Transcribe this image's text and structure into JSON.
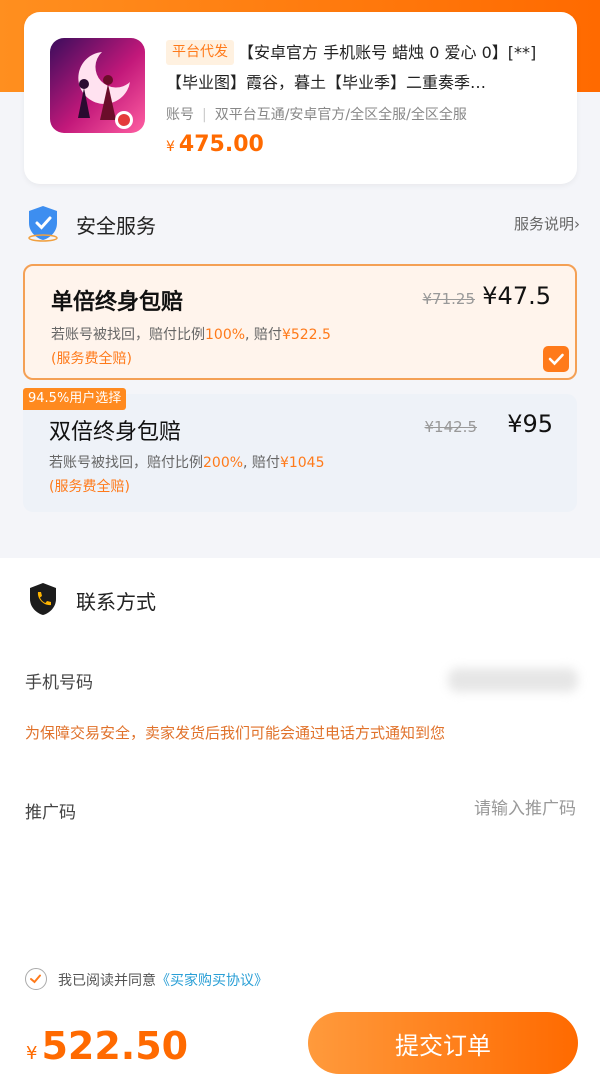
{
  "product": {
    "tag": "平台代发",
    "title": "【安卓官方 手机账号 蜡烛 0 爱心 0】[**]【毕业图】霞谷，暮土【毕业季】二重奏季…",
    "meta_type": "账号",
    "meta_detail": "双平台互通/安卓官方/全区全服/全区全服",
    "price_symbol": "¥",
    "price": "475.00"
  },
  "security": {
    "title": "安全服务",
    "help_link": "服务说明›",
    "options": [
      {
        "name": "单倍终身包赔",
        "old_price": "¥71.25",
        "price": "¥47.5",
        "desc_prefix": "若账号被找回，赔付比例",
        "ratio": "100%",
        "desc_mid": ", 赔付",
        "payout": "¥522.5",
        "fee_note": "(服务费全赔)",
        "selected": true
      },
      {
        "name": "双倍终身包赔",
        "old_price": "¥142.5",
        "price": "¥95",
        "desc_prefix": "若账号被找回，赔付比例",
        "ratio": "200%",
        "desc_mid": ", 赔付",
        "payout": "¥1045",
        "fee_note": "(服务费全赔)",
        "badge": "94.5%用户选择",
        "selected": false
      }
    ]
  },
  "contact": {
    "title": "联系方式",
    "phone_label": "手机号码",
    "notice": "为保障交易安全，卖家发货后我们可能会通过电话方式通知到您",
    "promo_label": "推广码",
    "promo_placeholder": "请输入推广码"
  },
  "footer": {
    "agree_text": "我已阅读并同意",
    "agree_link": "《买家购买协议》",
    "total_symbol": "¥",
    "total": "522.50",
    "submit_label": "提交订单"
  },
  "colors": {
    "accent": "#ff6a00",
    "link": "#2a9fd6"
  }
}
